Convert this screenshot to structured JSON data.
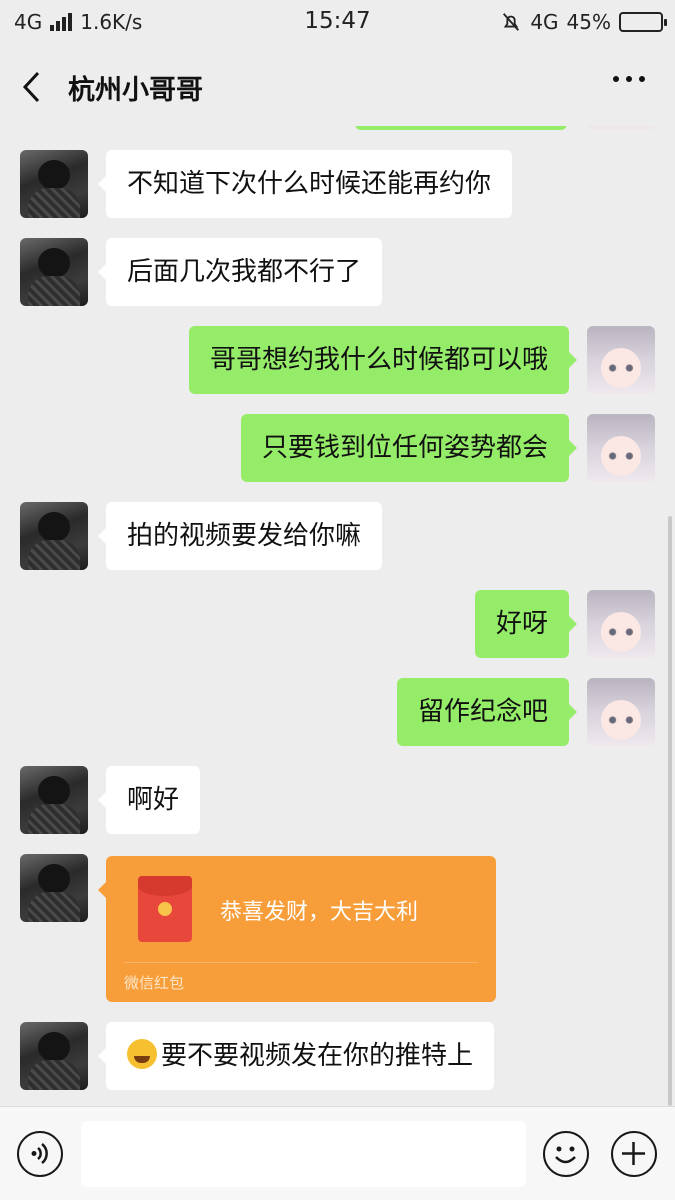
{
  "status_bar": {
    "network_left": "4G",
    "speed": "1.6K/s",
    "time": "15:47",
    "network_right": "4G",
    "battery": "45%",
    "battery_level": 0.45
  },
  "nav": {
    "title": "杭州小哥哥",
    "back_icon": "chevron-left-icon",
    "more_icon": "more-dots-icon"
  },
  "messages": [
    {
      "dir": "in",
      "text": "不知道下次什么时候还能再约你"
    },
    {
      "dir": "in",
      "text": "后面几次我都不行了"
    },
    {
      "dir": "out",
      "text": "哥哥想约我什么时候都可以哦"
    },
    {
      "dir": "out",
      "text": "只要钱到位任何姿势都会"
    },
    {
      "dir": "in",
      "text": "拍的视频要发给你嘛"
    },
    {
      "dir": "out",
      "text": "好呀"
    },
    {
      "dir": "out",
      "text": "留作纪念吧"
    },
    {
      "dir": "in",
      "text": "啊好"
    },
    {
      "dir": "in",
      "type": "red_packet",
      "text": "恭喜发财，大吉大利",
      "label": "微信红包"
    },
    {
      "dir": "in",
      "emoji": "facepalm-emoji",
      "text": "要不要视频发在你的推特上"
    }
  ],
  "input_bar": {
    "voice_icon": "voice-icon",
    "sticker_icon": "sticker-icon",
    "plus_icon": "plus-icon",
    "input_value": ""
  },
  "colors": {
    "background": "#ededed",
    "outgoing_bubble": "#95ec69",
    "incoming_bubble": "#ffffff",
    "red_packet": "#f79e3a"
  }
}
